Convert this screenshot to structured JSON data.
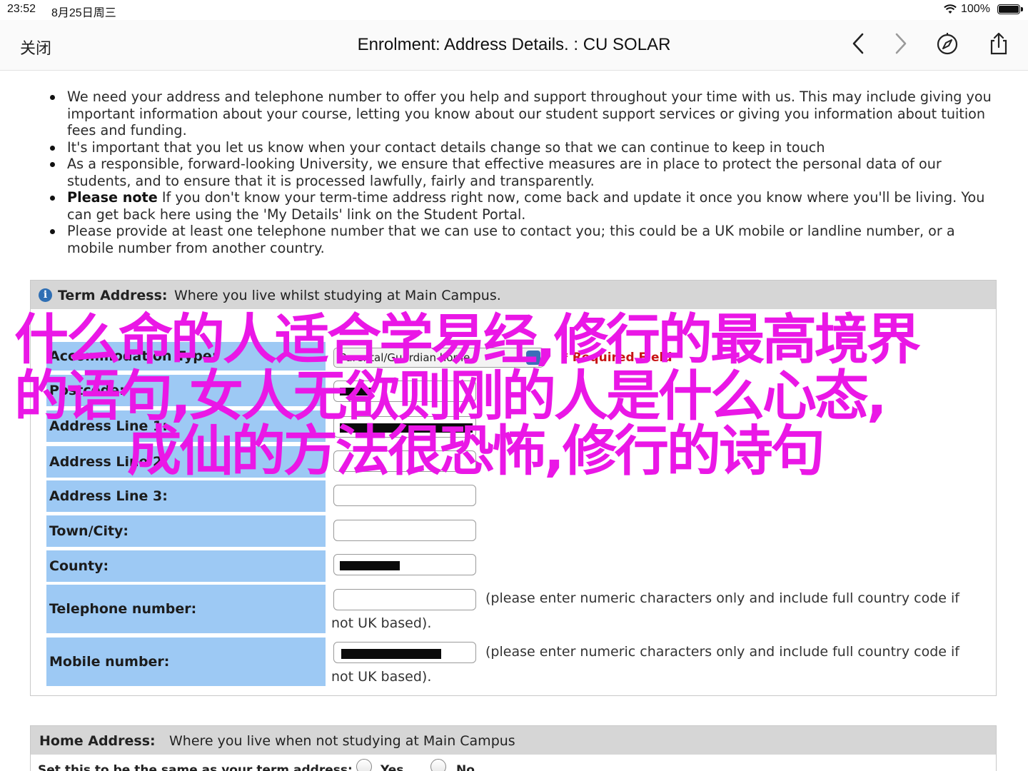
{
  "status_bar": {
    "time": "23:52",
    "date": "8月25日周三",
    "battery_pct": "100%",
    "battery_level": 1.0
  },
  "nav": {
    "close_label": "关闭",
    "title": "Enrolment: Address Details. : CU SOLAR",
    "icons": [
      "chevron-left-icon",
      "chevron-right-icon",
      "compass-icon",
      "share-icon"
    ]
  },
  "bullets": [
    {
      "strong": "",
      "text": "We need your address and telephone number to offer you help and support throughout your time with us. This may include giving you important information about your course, letting you know about our student support services or giving you information about tuition fees and funding."
    },
    {
      "strong": "",
      "text": "It's important that you let us know when your contact details change so that we can continue to keep in touch"
    },
    {
      "strong": "",
      "text": "As a responsible, forward-looking University, we ensure that effective measures are in place to protect the personal data of our students, and to ensure that it is processed lawfully, fairly and transparently."
    },
    {
      "strong": "Please note",
      "text": " If you don't know your term-time address right now, come back and update it once you know where you'll be living. You can get back here using the 'My Details' link on the Student Portal."
    },
    {
      "strong": "",
      "text": "Please provide at least one telephone number that we can use to contact you; this could be a UK mobile or landline number, or a mobile number from another country."
    }
  ],
  "term_address": {
    "title": "Term Address:",
    "description": "Where you live whilst studying at Main Campus.",
    "accommodation_label": "Accommodation Type:",
    "accommodation_value": "Parental/Guardian home",
    "required_text": "* Required Field",
    "postcode_label": "Postcode:",
    "address1_label": "Address Line 1:",
    "address2_label": "Address Line 2:",
    "address3_label": "Address Line 3:",
    "town_label": "Town/City:",
    "county_label": "County:",
    "telephone_label": "Telephone number:",
    "mobile_label": "Mobile number:",
    "phone_note_1": "(please enter numeric characters only and include full country code if",
    "phone_note_2": "not UK based).",
    "mobile_note_1": "(please enter numeric characters only and include full country code if",
    "mobile_note_2": "not UK based)."
  },
  "home_address": {
    "title": "Home Address:",
    "description": "Where you live when not studying at Main Campus",
    "same_label": "Set this to be the same as your term address:",
    "yes_label": "Yes",
    "no_label": "No"
  },
  "overlay": {
    "line1": "什么命的人适合学易经,修行的最高境界",
    "line2": "的语句,女人无欲则刚的人是什么心态,",
    "line3": "成仙的方法很恐怖,修行的诗句",
    "color": "#ea17e6"
  },
  "colors": {
    "label_bg": "#9dc9f4",
    "panel_header_bg": "#d6d6d6",
    "required": "#c81414",
    "info_icon": "#2f6fb4"
  }
}
